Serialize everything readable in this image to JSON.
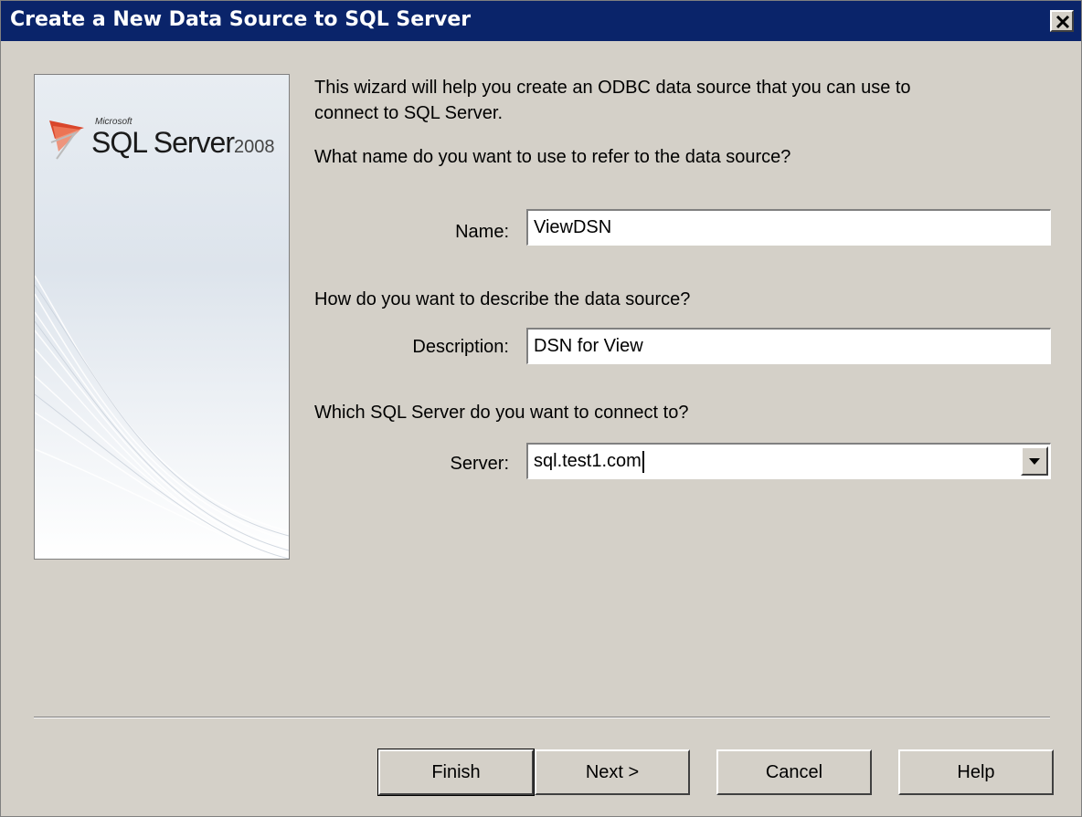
{
  "window": {
    "title": "Create a New Data Source to SQL Server"
  },
  "sidebar": {
    "logo_microsoft": "Microsoft",
    "logo_product": "SQL Server",
    "logo_year": "2008"
  },
  "intro": {
    "line1": "This wizard will help you create an ODBC data source that you can use to",
    "line2": "connect to SQL Server."
  },
  "name_section": {
    "question": "What name do you want to use to refer to the data source?",
    "label": "Name:",
    "value": "ViewDSN"
  },
  "description_section": {
    "question": "How do you want to describe the data source?",
    "label": "Description:",
    "value": "DSN for View"
  },
  "server_section": {
    "question": "Which SQL Server do you want to connect to?",
    "label": "Server:",
    "value": "sql.test1.com"
  },
  "buttons": {
    "finish": "Finish",
    "next": "Next >",
    "cancel": "Cancel",
    "help": "Help"
  }
}
